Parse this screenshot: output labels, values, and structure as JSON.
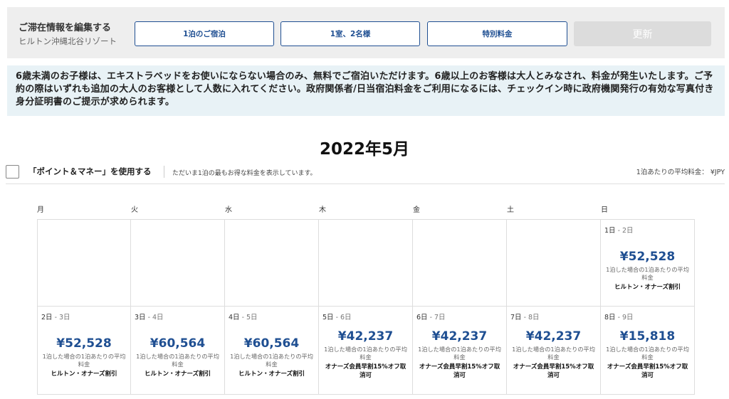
{
  "edit_bar": {
    "title": "ご滞在情報を編集する",
    "hotel": "ヒルトン沖縄北谷リゾート",
    "nights_button": "1泊のご宿泊",
    "guests_button": "1室、2名様",
    "rate_button": "特別料金",
    "update_button": "更新"
  },
  "notice": "6歳未満のお子様は、エキストラベッドをお使いにならない場合のみ、無料でご宿泊いただけます。6歳以上のお客様は大人とみなされ、料金が発生いたします。ご予約の際はいずれも追加の大人のお客様として人数に入れてください。政府関係者/日当宿泊料金をご利用になるには、チェックイン時に政府機関発行の有効な写真付き身分証明書のご提示が求められます。",
  "calendar": {
    "month_title": "2022年5月",
    "points_label": "「ポイント＆マネー」を使用する",
    "points_note": "ただいま1泊の最もお得な料金を表示しています。",
    "avg_note": "1泊あたりの平均料金： ¥JPY",
    "weekdays": [
      "月",
      "火",
      "水",
      "木",
      "金",
      "土",
      "日"
    ],
    "weeks": [
      [
        null,
        null,
        null,
        null,
        null,
        null,
        {
          "start": "1日",
          "end": "2日",
          "price": "¥52,528",
          "avg_note": "1泊した場合の1泊あたりの平均料金",
          "rate_name": "ヒルトン・オナーズ割引"
        }
      ],
      [
        {
          "start": "2日",
          "end": "3日",
          "price": "¥52,528",
          "avg_note": "1泊した場合の1泊あたりの平均料金",
          "rate_name": "ヒルトン・オナーズ割引"
        },
        {
          "start": "3日",
          "end": "4日",
          "price": "¥60,564",
          "avg_note": "1泊した場合の1泊あたりの平均料金",
          "rate_name": "ヒルトン・オナーズ割引"
        },
        {
          "start": "4日",
          "end": "5日",
          "price": "¥60,564",
          "avg_note": "1泊した場合の1泊あたりの平均料金",
          "rate_name": "ヒルトン・オナーズ割引"
        },
        {
          "start": "5日",
          "end": "6日",
          "price": "¥42,237",
          "avg_note": "1泊した場合の1泊あたりの平均料金",
          "rate_name": "オナーズ会員早割15%オフ取消可"
        },
        {
          "start": "6日",
          "end": "7日",
          "price": "¥42,237",
          "avg_note": "1泊した場合の1泊あたりの平均料金",
          "rate_name": "オナーズ会員早割15%オフ取消可"
        },
        {
          "start": "7日",
          "end": "8日",
          "price": "¥42,237",
          "avg_note": "1泊した場合の1泊あたりの平均料金",
          "rate_name": "オナーズ会員早割15%オフ取消可"
        },
        {
          "start": "8日",
          "end": "9日",
          "price": "¥15,818",
          "avg_note": "1泊した場合の1泊あたりの平均料金",
          "rate_name": "オナーズ会員早割15%オフ取消可"
        }
      ]
    ]
  },
  "colors": {
    "accent": "#1f4f92",
    "notice_bg": "#e8f2f6",
    "edit_bg": "#eeeeee"
  }
}
